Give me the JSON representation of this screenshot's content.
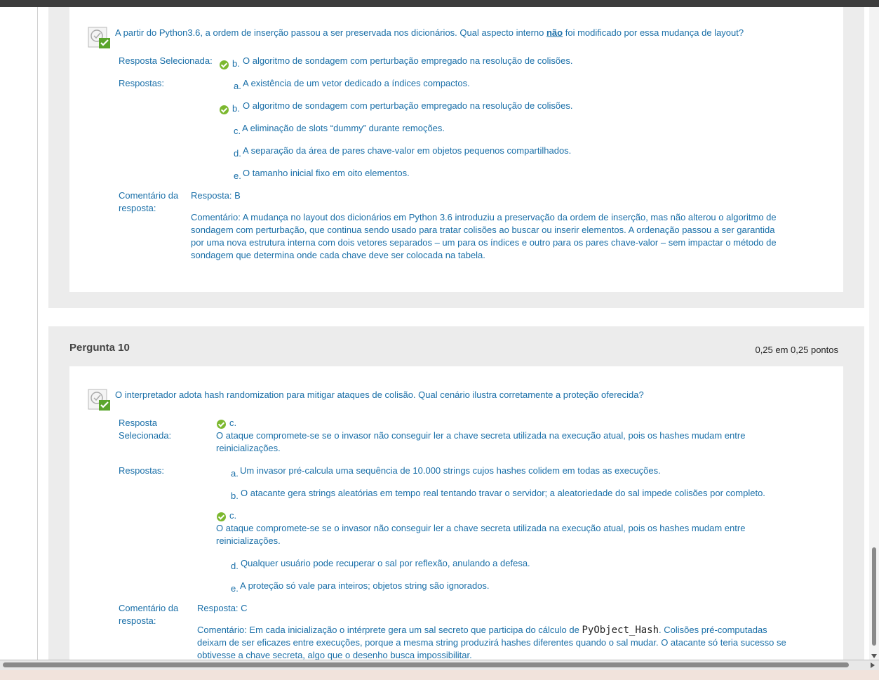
{
  "q9": {
    "question_prefix": "A partir do Python",
    "question_mid": "3.6, a ordem de inserção passou a ser preservada nos dicionários. Qual aspecto interno ",
    "question_emph": "não",
    "question_suffix": " foi modificado por essa mudança de layout?",
    "selected_label": "Resposta Selecionada:",
    "selected_letter": "b.",
    "selected_text": "O algoritmo de sondagem com perturbação empregado na resolução de colisões.",
    "answers_label": "Respostas:",
    "answers": [
      {
        "letter": "a.",
        "text": "A existência de um vetor dedicado a índices compactos."
      },
      {
        "letter": "b.",
        "text": "O algoritmo de sondagem com perturbação empregado na resolução de colisões."
      },
      {
        "letter": "c.",
        "text": "A eliminação de slots “dummy” durante remoções."
      },
      {
        "letter": "d.",
        "text": "A separação da área de pares chave-valor em objetos pequenos compartilhados."
      },
      {
        "letter": "e.",
        "text": "O tamanho inicial fixo em oito elementos."
      }
    ],
    "comment_label_1": "Comentário da",
    "comment_label_2": "resposta:",
    "comment_answer": "Resposta: B",
    "comment_lines": [
      "Comentário: A mudança no layout dos dicionários em Python 3.6 introduziu a preservação da ordem de inserção, mas não alterou o algoritmo de",
      "sondagem com perturbação, que continua sendo usado para tratar colisões ao buscar ou inserir elementos. A ordenação passou a ser garantida",
      "por uma nova estrutura interna com dois vetores separados – um para os índices e outro para os pares chave-valor – sem impactar o método de",
      "sondagem que determina onde cada chave deve ser colocada na tabela."
    ]
  },
  "q10": {
    "title": "Pergunta 10",
    "points": "0,25 em 0,25 pontos",
    "question": "O interpretador adota hash randomization para mitigar ataques de colisão. Qual cenário ilustra corretamente a proteção oferecida?",
    "selected_label_1": "Resposta",
    "selected_label_2": "Selecionada:",
    "selected_letter": "c.",
    "selected_line1": "O ataque compromete-se se o invasor não conseguir ler a chave secreta utilizada na execução atual, pois os hashes mudam entre",
    "selected_line2": "reinicializações.",
    "answers_label": "Respostas:",
    "answers": [
      {
        "letter": "a.",
        "text": "Um invasor pré-calcula uma sequência de 10.000 strings cujos hashes colidem em todas as execuções."
      },
      {
        "letter": "b.",
        "text": "O atacante gera strings aleatórias em tempo real tentando travar o servidor; a aleatoriedade do sal impede colisões por completo."
      },
      {
        "letter": "c.",
        "line1": "O ataque compromete-se se o invasor não conseguir ler a chave secreta utilizada na execução atual, pois os hashes mudam entre",
        "line2": "reinicializações."
      },
      {
        "letter": "d.",
        "text": "Qualquer usuário pode recuperar o sal por reflexão, anulando a defesa."
      },
      {
        "letter": "e.",
        "text": "A proteção só vale para inteiros; objetos string são ignorados."
      }
    ],
    "comment_label_1": "Comentário da",
    "comment_label_2": "resposta:",
    "comment_answer": "Resposta: C",
    "comment_l1_pre": "Comentário: Em cada inicialização o intérprete gera um sal secreto que participa do cálculo de ",
    "comment_l1_code": "PyObject_Hash",
    "comment_l1_post": ". Colisões pré-computadas",
    "comment_l2": "deixam de ser eficazes entre execuções, porque a mesma string produzirá hashes diferentes quando o sal mudar. O atacante só teria sucesso se",
    "comment_l3": "obtivesse a chave secreta, algo que o desenho busca impossibilitar."
  },
  "colors": {
    "accent": "#1a6fa8",
    "check": "#7cb82f",
    "panel": "#ececec"
  }
}
